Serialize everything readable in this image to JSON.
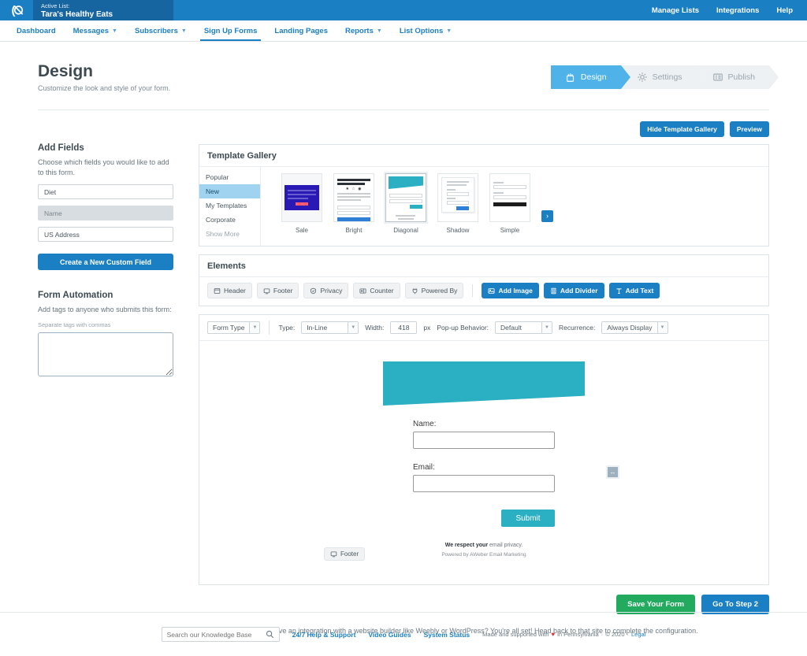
{
  "topbar": {
    "logo": "aweber-logo",
    "active_list_label": "Active List:",
    "active_list_name": "Tara's Healthy Eats",
    "links": [
      {
        "label": "Manage Lists"
      },
      {
        "label": "Integrations"
      },
      {
        "label": "Help"
      }
    ]
  },
  "nav": {
    "items": [
      {
        "label": "Dashboard",
        "caret": false,
        "active": false
      },
      {
        "label": "Messages",
        "caret": true,
        "active": false
      },
      {
        "label": "Subscribers",
        "caret": true,
        "active": false
      },
      {
        "label": "Sign Up Forms",
        "caret": false,
        "active": true
      },
      {
        "label": "Landing Pages",
        "caret": false,
        "active": false
      },
      {
        "label": "Reports",
        "caret": true,
        "active": false
      },
      {
        "label": "List Options",
        "caret": true,
        "active": false
      }
    ]
  },
  "page": {
    "title": "Design",
    "subtitle": "Customize the look and style of your form."
  },
  "steps": [
    {
      "label": "Design",
      "icon": "form-design-icon",
      "active": true
    },
    {
      "label": "Settings",
      "icon": "gear-icon",
      "active": false
    },
    {
      "label": "Publish",
      "icon": "list-publish-icon",
      "active": false
    }
  ],
  "add_fields": {
    "title": "Add Fields",
    "description": "Choose which fields you would like to add to this form.",
    "fields": [
      {
        "label": "Diet",
        "disabled": false
      },
      {
        "label": "Name",
        "disabled": true
      },
      {
        "label": "US Address",
        "disabled": false
      }
    ],
    "create_button": "Create a New Custom Field"
  },
  "form_automation": {
    "title": "Form Automation",
    "description": "Add tags to anyone who submits this form:",
    "hint": "Separate tags with commas",
    "tags_value": ""
  },
  "top_actions": {
    "hide_gallery": "Hide Template Gallery",
    "preview": "Preview"
  },
  "template_gallery": {
    "title": "Template Gallery",
    "categories": [
      {
        "label": "Popular",
        "active": false,
        "muted": false
      },
      {
        "label": "New",
        "active": true,
        "muted": false
      },
      {
        "label": "My Templates",
        "active": false,
        "muted": false
      },
      {
        "label": "Corporate",
        "active": false,
        "muted": false
      },
      {
        "label": "Show More",
        "active": false,
        "muted": true
      }
    ],
    "templates": [
      {
        "label": "Sale",
        "selected": false
      },
      {
        "label": "Bright",
        "selected": false
      },
      {
        "label": "Diagonal",
        "selected": true
      },
      {
        "label": "Shadow",
        "selected": false
      },
      {
        "label": "Simple",
        "selected": false
      }
    ],
    "next_arrow": "›"
  },
  "elements": {
    "title": "Elements",
    "buttons": [
      {
        "label": "Header",
        "icon": "header-icon"
      },
      {
        "label": "Footer",
        "icon": "footer-monitor-icon"
      },
      {
        "label": "Privacy",
        "icon": "shield-icon"
      },
      {
        "label": "Counter",
        "icon": "counter-icon"
      },
      {
        "label": "Powered By",
        "icon": "plug-icon"
      }
    ],
    "primary_buttons": [
      {
        "label": "Add Image",
        "icon": "image-icon"
      },
      {
        "label": "Add Divider",
        "icon": "divider-icon"
      },
      {
        "label": "Add Text",
        "icon": "text-icon"
      }
    ]
  },
  "form_settings": {
    "form_type_select": "Form Type",
    "type_label": "Type:",
    "type_value": "In-Line",
    "width_label": "Width:",
    "width_value": "418",
    "width_unit": "px",
    "popup_label": "Pop-up Behavior:",
    "popup_value": "Default",
    "recurrence_label": "Recurrence:",
    "recurrence_value": "Always Display"
  },
  "form_preview": {
    "banner_color": "#2bafc2",
    "name_label": "Name:",
    "name_value": "",
    "email_label": "Email:",
    "email_value": "",
    "submit_label": "Submit",
    "privacy_bold": "We respect your",
    "privacy_rest": " email privacy.",
    "powered_by": "Powered by AWeber Email Marketing",
    "footer_tag_label": "Footer",
    "resize_icon": "↔"
  },
  "bottom_actions": {
    "save": "Save Your Form",
    "next": "Go To Step 2"
  },
  "hint": "Have an integration with a website builder like Weebly or WordPress? You're all set! Head back to that site to complete the configuration.",
  "site_footer": {
    "search_placeholder": "Search our Knowledge Base",
    "search_value": "",
    "links": [
      {
        "label": "24/7 Help & Support"
      },
      {
        "label": "Video Guides"
      },
      {
        "label": "System Status"
      }
    ],
    "made_prefix": "Made and supported with",
    "made_suffix": "in Pennsylvania",
    "sep1": "·",
    "copyright": "© 2020",
    "sep2": "·",
    "legal": "Legal"
  }
}
